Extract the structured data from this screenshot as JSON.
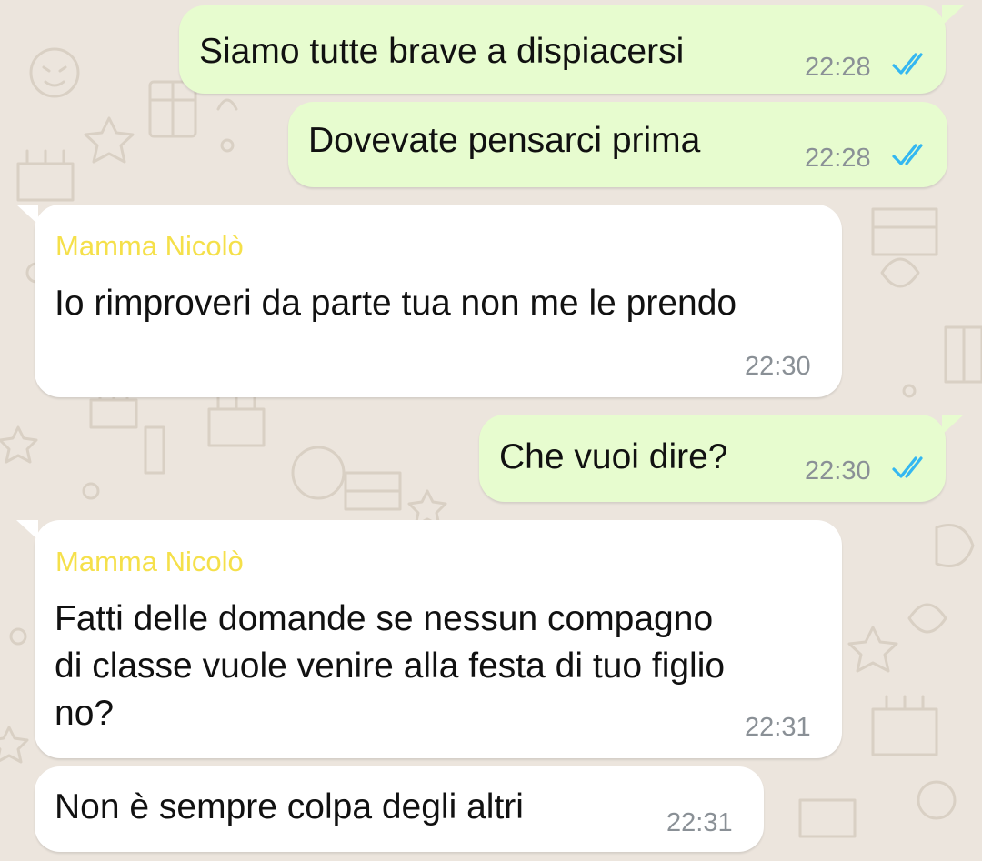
{
  "colors": {
    "background": "#ece5dd",
    "outgoing_bubble": "#e7fccf",
    "incoming_bubble": "#ffffff",
    "sender_name": "#f5e04a",
    "read_ticks": "#34b7f1",
    "timestamp": "#8a9096"
  },
  "messages": [
    {
      "direction": "outgoing",
      "text": "Siamo tutte brave a dispiacersi",
      "time": "22:28",
      "status_icon": "double-check-read-icon"
    },
    {
      "direction": "outgoing",
      "text": "Dovevate pensarci prima",
      "time": "22:28",
      "status_icon": "double-check-read-icon"
    },
    {
      "direction": "incoming",
      "sender": "Mamma Nicolò",
      "text": "Io rimproveri da parte tua non me le prendo",
      "time": "22:30"
    },
    {
      "direction": "outgoing",
      "text": "Che vuoi dire?",
      "time": "22:30",
      "status_icon": "double-check-read-icon"
    },
    {
      "direction": "incoming",
      "sender": "Mamma Nicolò",
      "lines": [
        "Fatti delle domande se nessun compagno",
        "di classe vuole venire alla festa di tuo figlio",
        "no?"
      ],
      "time": "22:31"
    },
    {
      "direction": "incoming",
      "text": "Non è sempre colpa degli altri",
      "time": "22:31"
    }
  ]
}
